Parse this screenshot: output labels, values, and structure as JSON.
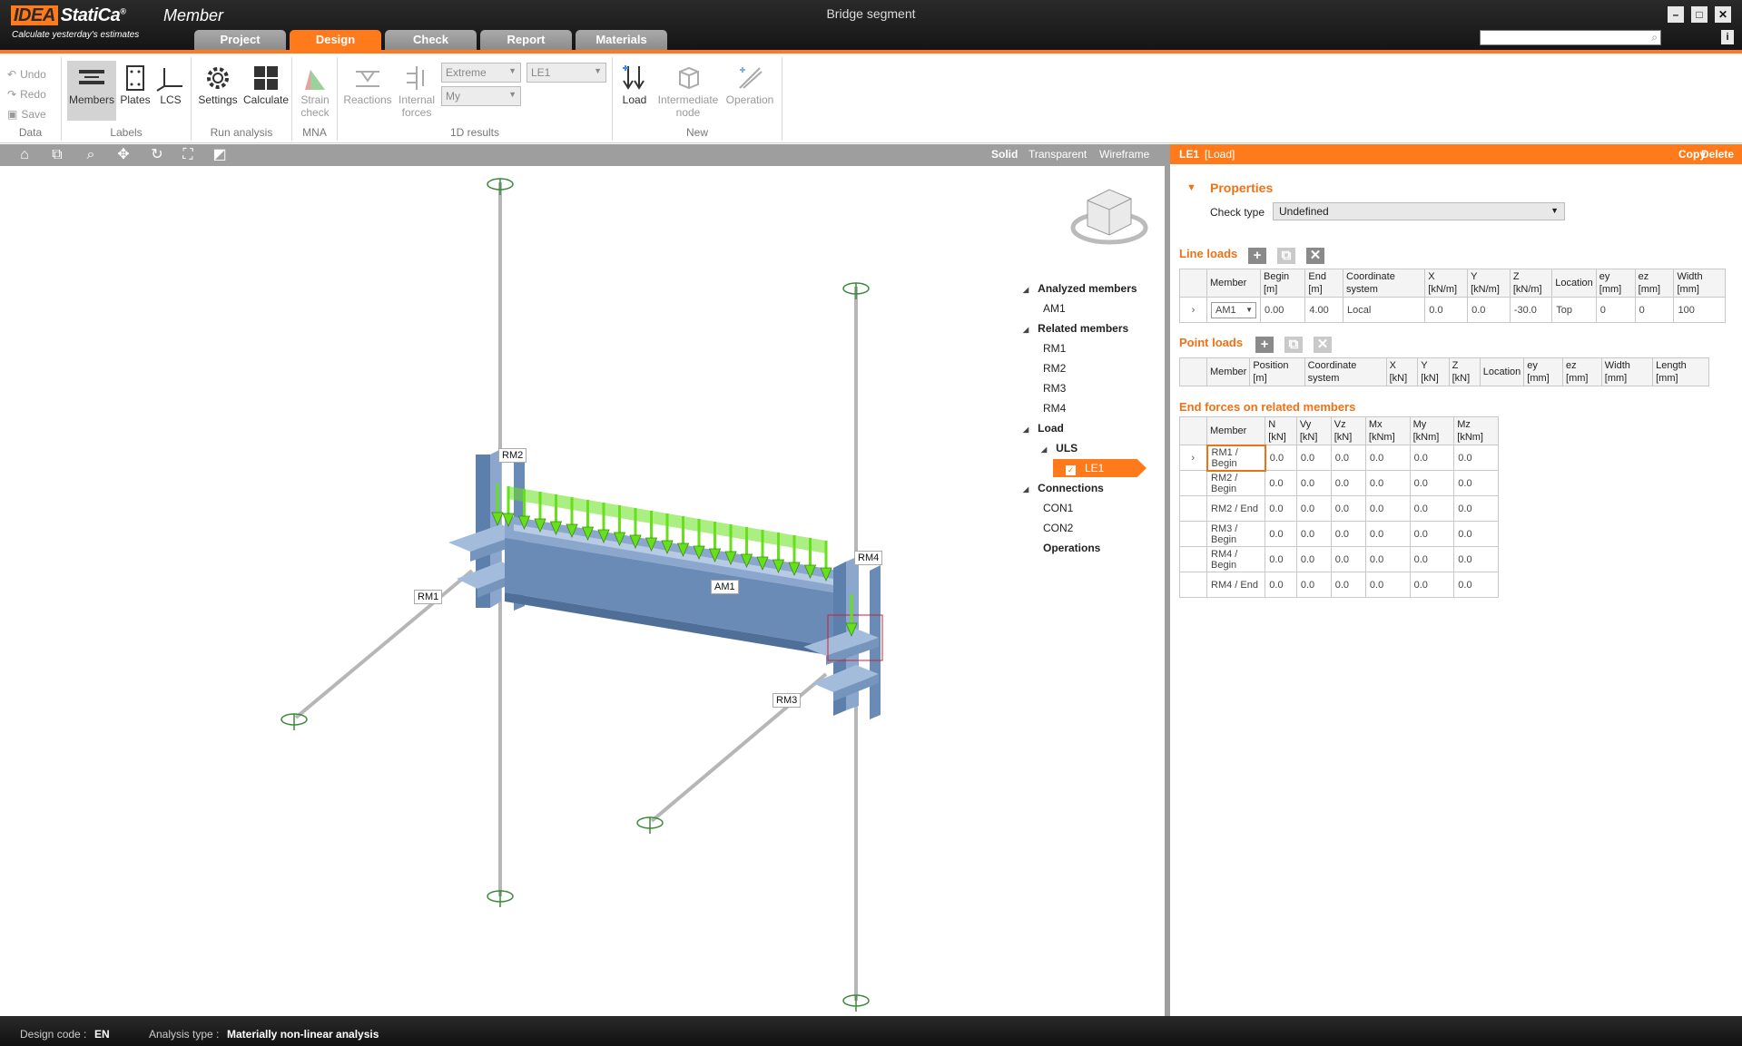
{
  "app": {
    "logo_idea": "IDEA",
    "logo_statica": "StatiCa",
    "logo_reg": "®",
    "product": "Member",
    "slogan": "Calculate yesterday's estimates",
    "doc_title": "Bridge segment"
  },
  "tabs": [
    {
      "label": "Project"
    },
    {
      "label": "Design"
    },
    {
      "label": "Check"
    },
    {
      "label": "Report"
    },
    {
      "label": "Materials"
    }
  ],
  "ribbon": {
    "data": {
      "undo": "Undo",
      "redo": "Redo",
      "save": "Save",
      "group": "Data"
    },
    "labels": {
      "members": "Members",
      "plates": "Plates",
      "lcs": "LCS",
      "group": "Labels"
    },
    "run": {
      "settings": "Settings",
      "calculate": "Calculate",
      "group": "Run analysis"
    },
    "mna": {
      "strain_1": "Strain",
      "strain_2": "check",
      "group": "MNA"
    },
    "results": {
      "reactions": "Reactions",
      "internal_1": "Internal",
      "internal_2": "forces",
      "combo_extreme": "Extreme",
      "combo_le": "LE1",
      "combo_my": "My",
      "group": "1D results"
    },
    "new": {
      "load": "Load",
      "inode_1": "Intermediate",
      "inode_2": "node",
      "operation": "Operation",
      "group": "New"
    }
  },
  "viewport": {
    "modes": {
      "solid": "Solid",
      "transparent": "Transparent",
      "wireframe": "Wireframe"
    },
    "labels": {
      "rm1": "RM1",
      "rm2": "RM2",
      "rm3": "RM3",
      "rm4": "RM4",
      "am1": "AM1"
    }
  },
  "tree": {
    "analyzed": "Analyzed members",
    "am1": "AM1",
    "related": "Related members",
    "rm1": "RM1",
    "rm2": "RM2",
    "rm3": "RM3",
    "rm4": "RM4",
    "load": "Load",
    "uls": "ULS",
    "le1": "LE1",
    "connections": "Connections",
    "con1": "CON1",
    "con2": "CON2",
    "operations": "Operations"
  },
  "panel": {
    "header_id": "LE1",
    "header_type": "[Load]",
    "copy": "Copy",
    "delete": "Delete",
    "properties_title": "Properties",
    "check_type_label": "Check type",
    "check_type_value": "Undefined",
    "line_loads": {
      "title": "Line loads",
      "headers": [
        "Member",
        "Begin [m]",
        "End [m]",
        "Coordinate system",
        "X [kN/m]",
        "Y [kN/m]",
        "Z [kN/m]",
        "Location",
        "ey [mm]",
        "ez [mm]",
        "Width [mm]"
      ],
      "rows": [
        {
          "member": "AM1",
          "begin": "0.00",
          "end": "4.00",
          "cs": "Local",
          "x": "0.0",
          "y": "0.0",
          "z": "-30.0",
          "location": "Top",
          "ey": "0",
          "ez": "0",
          "width": "100"
        }
      ]
    },
    "point_loads": {
      "title": "Point loads",
      "headers": [
        "Member",
        "Position [m]",
        "Coordinate system",
        "X [kN]",
        "Y [kN]",
        "Z [kN]",
        "Location",
        "ey [mm]",
        "ez [mm]",
        "Width [mm]",
        "Length [mm]"
      ]
    },
    "end_forces": {
      "title": "End forces on related members",
      "headers": [
        "Member",
        "N [kN]",
        "Vy [kN]",
        "Vz [kN]",
        "Mx [kNm]",
        "My [kNm]",
        "Mz [kNm]"
      ],
      "rows": [
        {
          "member": "RM1 / Begin",
          "v": [
            "0.0",
            "0.0",
            "0.0",
            "0.0",
            "0.0",
            "0.0"
          ]
        },
        {
          "member": "RM2 / Begin",
          "v": [
            "0.0",
            "0.0",
            "0.0",
            "0.0",
            "0.0",
            "0.0"
          ]
        },
        {
          "member": "RM2 / End",
          "v": [
            "0.0",
            "0.0",
            "0.0",
            "0.0",
            "0.0",
            "0.0"
          ]
        },
        {
          "member": "RM3 / Begin",
          "v": [
            "0.0",
            "0.0",
            "0.0",
            "0.0",
            "0.0",
            "0.0"
          ]
        },
        {
          "member": "RM4 / Begin",
          "v": [
            "0.0",
            "0.0",
            "0.0",
            "0.0",
            "0.0",
            "0.0"
          ]
        },
        {
          "member": "RM4 / End",
          "v": [
            "0.0",
            "0.0",
            "0.0",
            "0.0",
            "0.0",
            "0.0"
          ]
        }
      ]
    }
  },
  "status": {
    "design_code_label": "Design code :",
    "design_code_value": "EN",
    "analysis_type_label": "Analysis type :",
    "analysis_type_value": "Materially non-linear analysis"
  },
  "colors": {
    "accent": "#ff7a1a",
    "steel": "#7d9cc4",
    "load": "#66e01a"
  }
}
